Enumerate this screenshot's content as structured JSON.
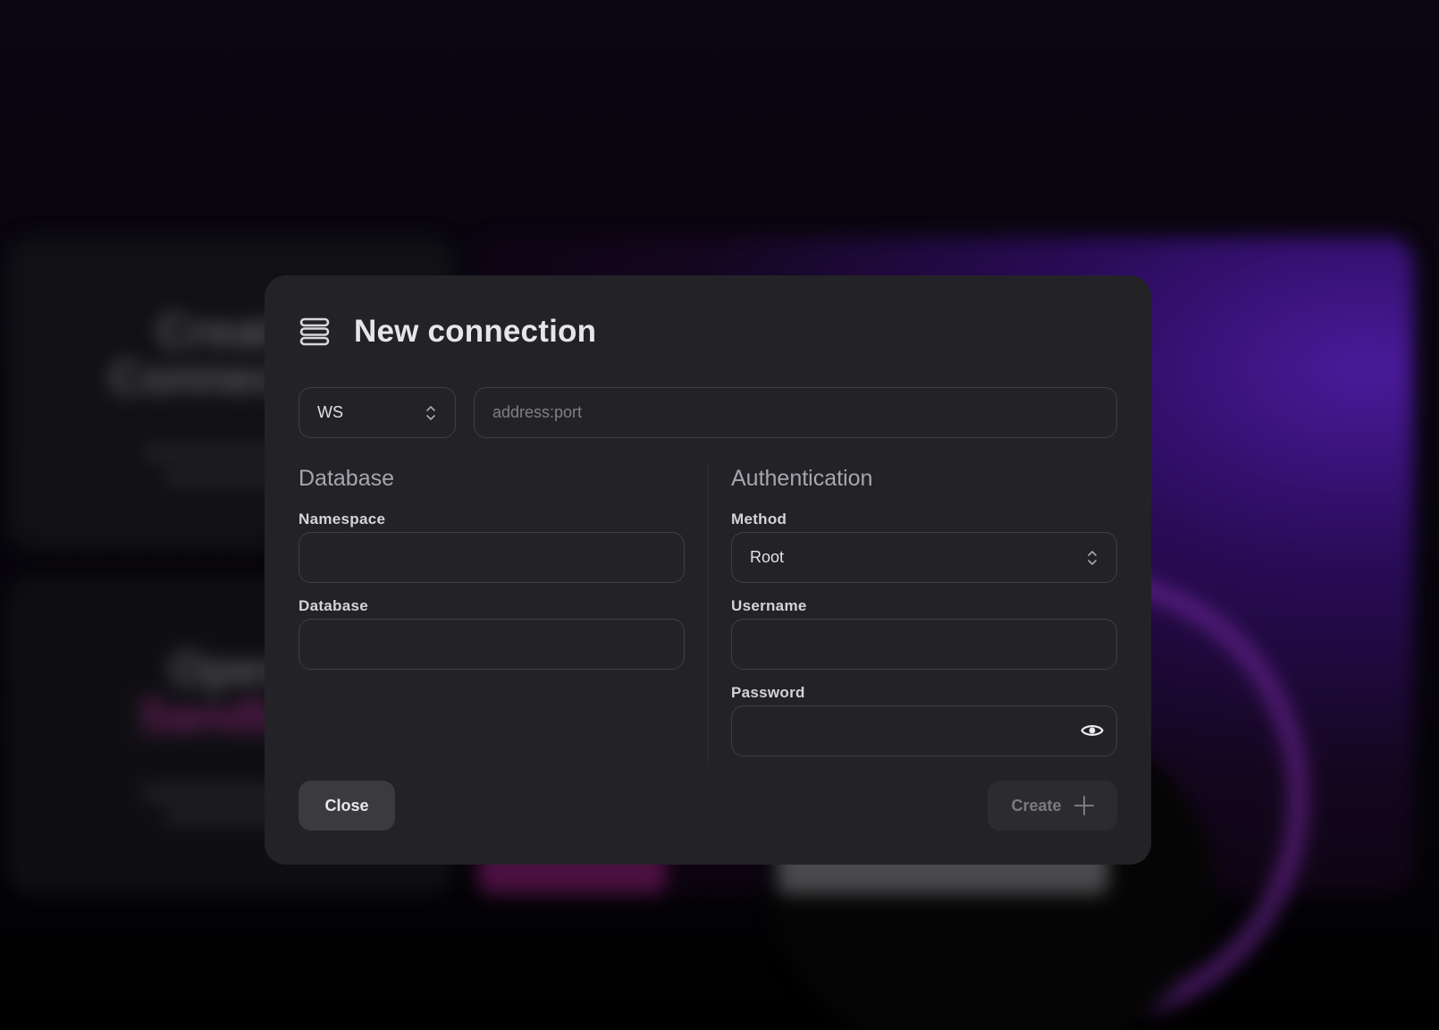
{
  "background": {
    "card1_title_line1": "Creat",
    "card1_title_line2": "Connec",
    "card2_title_line1": "Open",
    "card2_title_line2": "Sandb"
  },
  "dialog": {
    "title": "New connection",
    "title_icon": "database-stack-icon"
  },
  "connection": {
    "protocol_value": "WS",
    "address_placeholder": "address:port",
    "address_value": ""
  },
  "database_section": {
    "title": "Database",
    "namespace_label": "Namespace",
    "namespace_value": "",
    "database_label": "Database",
    "database_value": ""
  },
  "auth_section": {
    "title": "Authentication",
    "method_label": "Method",
    "method_value": "Root",
    "username_label": "Username",
    "username_value": "",
    "password_label": "Password",
    "password_value": ""
  },
  "actions": {
    "close_label": "Close",
    "create_label": "Create"
  },
  "colors": {
    "modal_bg": "#232327",
    "border": "#3e3e44",
    "accent_purple": "#7a2aa8"
  }
}
